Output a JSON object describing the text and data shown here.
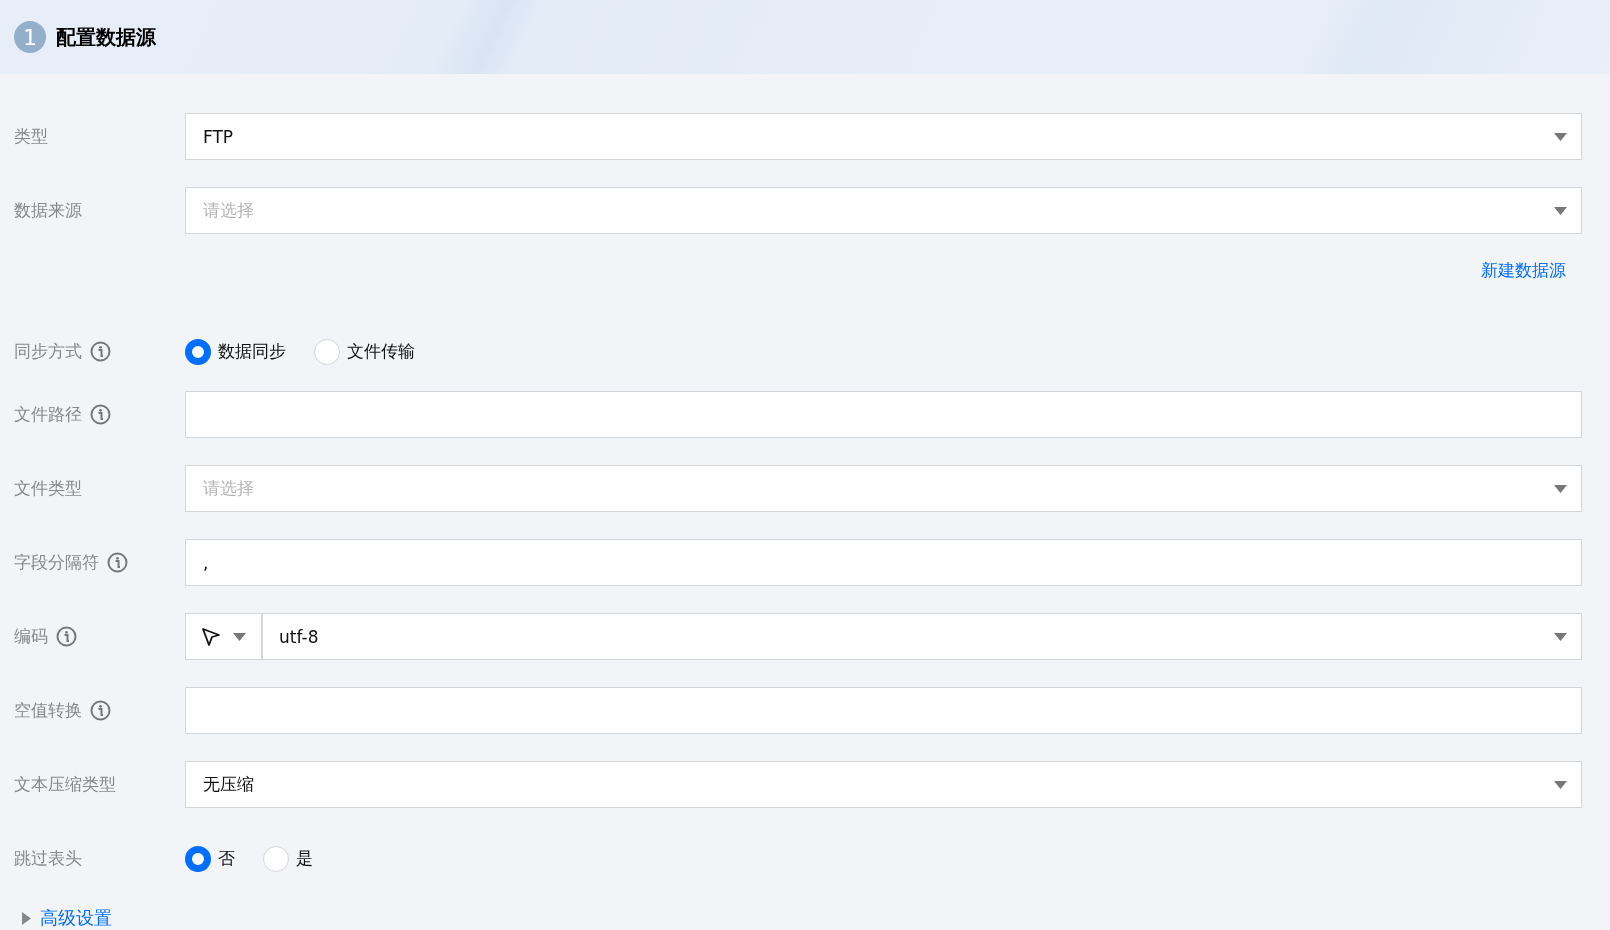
{
  "header": {
    "step": "1",
    "title": "配置数据源"
  },
  "rows": [
    {
      "kind": "select",
      "label": "类型",
      "info": false,
      "value": "FTP"
    },
    {
      "kind": "select",
      "label": "数据来源",
      "info": false,
      "placeholder": "请选择"
    },
    {
      "kind": "link",
      "text": "新建数据源"
    },
    {
      "kind": "radio",
      "label": "同步方式",
      "info": true,
      "options": [
        {
          "label": "数据同步",
          "selected": true
        },
        {
          "label": "文件传输",
          "selected": false
        }
      ]
    },
    {
      "kind": "input",
      "label": "文件路径",
      "info": true
    },
    {
      "kind": "select",
      "label": "文件类型",
      "info": false,
      "placeholder": "请选择"
    },
    {
      "kind": "input",
      "label": "字段分隔符",
      "info": true,
      "value": ","
    },
    {
      "kind": "encoding",
      "label": "编码",
      "info": true,
      "value": "utf-8"
    },
    {
      "kind": "input",
      "label": "空值转换",
      "info": true
    },
    {
      "kind": "select",
      "label": "文本压缩类型",
      "info": false,
      "value": "无压缩"
    },
    {
      "kind": "radio",
      "label": "跳过表头",
      "info": false,
      "options": [
        {
          "label": "否",
          "selected": true
        },
        {
          "label": "是",
          "selected": false
        }
      ]
    }
  ],
  "advanced": {
    "label": "高级设置",
    "expanded": false
  }
}
